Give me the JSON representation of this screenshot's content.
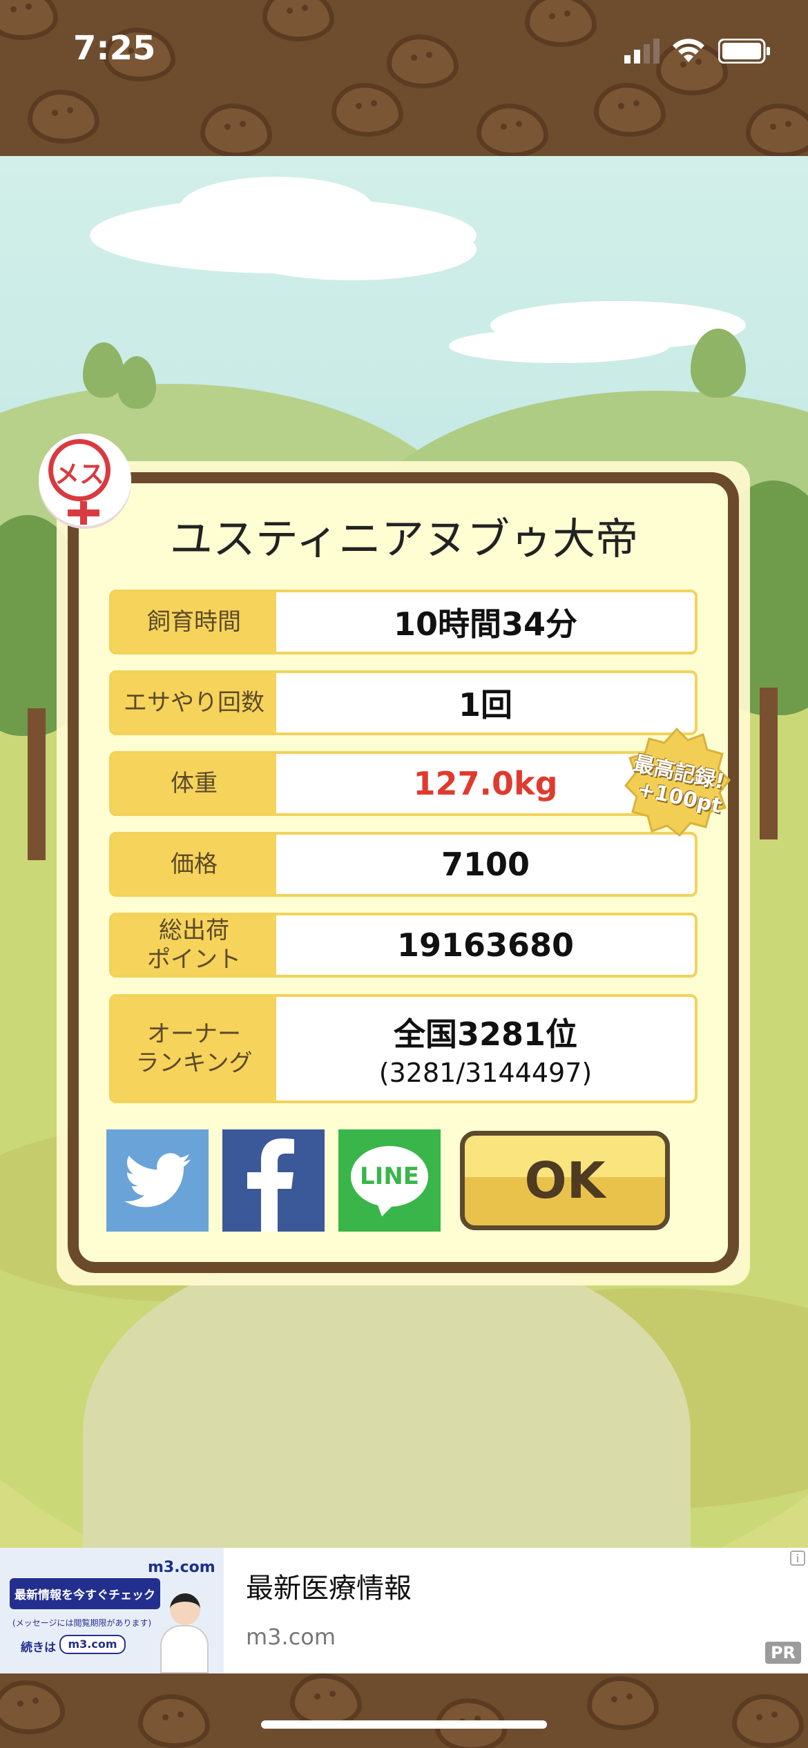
{
  "status_bar": {
    "time": "7:25"
  },
  "pig": {
    "gender_badge": "メス",
    "name": "ユスティニアヌブゥ大帝"
  },
  "stats": [
    {
      "label": "飼育時間",
      "value": "10時間34分"
    },
    {
      "label": "エサやり回数",
      "value": "1回"
    },
    {
      "label": "体重",
      "value": "127.0kg",
      "highlight_color": "#e03a2e"
    },
    {
      "label": "価格",
      "value": "7100"
    },
    {
      "label": "総出荷\nポイント",
      "value": "19163680"
    },
    {
      "label": "オーナー\nランキング",
      "value": "全国3281位",
      "sub": "(3281/3144497)"
    }
  ],
  "record_badge": {
    "line1": "最高記録!",
    "line2": "+100pt"
  },
  "share": {
    "twitter_color": "#6aa3d8",
    "facebook_color": "#3b5898",
    "line_color": "#3ab54a",
    "line_label": "LINE"
  },
  "ok_button": {
    "label": "OK"
  },
  "ad": {
    "image_headline": "最新情報を今すぐチェック",
    "image_note": "(メッセージには閲覧期限があります)",
    "image_cta_prefix": "続きは",
    "image_cta": "m3.com",
    "image_logo": "m3.com",
    "title": "最新医療情報",
    "domain": "m3.com",
    "pr": "PR",
    "info": "i"
  }
}
